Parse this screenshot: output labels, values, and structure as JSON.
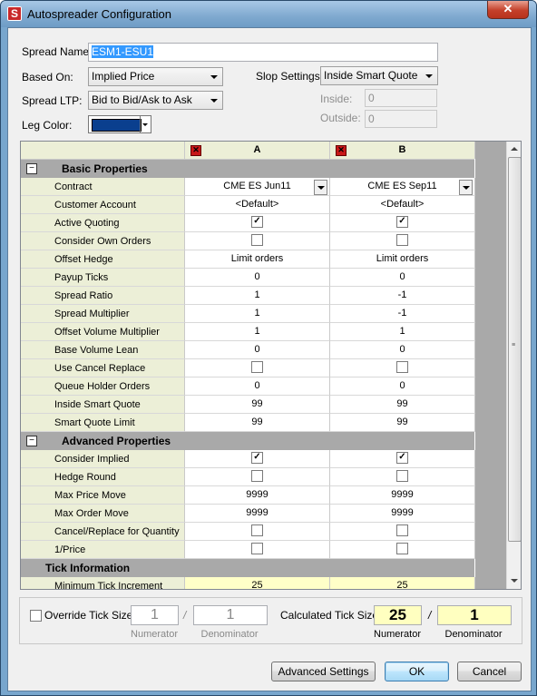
{
  "window": {
    "title": "Autospreader Configuration",
    "close_glyph": "✕"
  },
  "form": {
    "spread_name_label": "Spread Name:",
    "spread_name_value": "ESM1-ESU1",
    "based_on_label": "Based On:",
    "based_on_value": "Implied Price",
    "spread_ltp_label": "Spread LTP:",
    "spread_ltp_value": "Bid to Bid/Ask to Ask",
    "leg_color_label": "Leg Color:",
    "leg_color_value": "#0a3f8e",
    "slop_settings_label": "Slop Settings:",
    "slop_settings_value": "Inside Smart Quote",
    "inside_label": "Inside:",
    "inside_value": "0",
    "outside_label": "Outside:",
    "outside_value": "0"
  },
  "grid": {
    "col_a": "A",
    "col_b": "B",
    "sections": [
      {
        "title": "Basic Properties",
        "collapsible": true
      },
      {
        "title": "Advanced Properties",
        "collapsible": true
      },
      {
        "title": "Tick Information",
        "collapsible": false
      }
    ],
    "basic_rows": [
      {
        "label": "Contract",
        "a": "CME ES Jun11",
        "b": "CME ES Sep11",
        "kind": "dropdown"
      },
      {
        "label": "Customer Account",
        "a": "<Default>",
        "b": "<Default>",
        "kind": "text"
      },
      {
        "label": "Active Quoting",
        "a": "✓",
        "b": "✓",
        "kind": "check"
      },
      {
        "label": "Consider Own Orders",
        "a": "",
        "b": "",
        "kind": "check"
      },
      {
        "label": "Offset Hedge",
        "a": "Limit orders",
        "b": "Limit orders",
        "kind": "text"
      },
      {
        "label": "Payup Ticks",
        "a": "0",
        "b": "0",
        "kind": "text"
      },
      {
        "label": "Spread Ratio",
        "a": "1",
        "b": "-1",
        "kind": "text"
      },
      {
        "label": "Spread Multiplier",
        "a": "1",
        "b": "-1",
        "kind": "text"
      },
      {
        "label": "Offset Volume Multiplier",
        "a": "1",
        "b": "1",
        "kind": "text"
      },
      {
        "label": "Base Volume Lean",
        "a": "0",
        "b": "0",
        "kind": "text"
      },
      {
        "label": "Use Cancel Replace",
        "a": "",
        "b": "",
        "kind": "check"
      },
      {
        "label": "Queue Holder Orders",
        "a": "0",
        "b": "0",
        "kind": "text"
      },
      {
        "label": "Inside Smart Quote",
        "a": "99",
        "b": "99",
        "kind": "text"
      },
      {
        "label": "Smart Quote Limit",
        "a": "99",
        "b": "99",
        "kind": "text"
      }
    ],
    "advanced_rows": [
      {
        "label": "Consider Implied",
        "a": "✓",
        "b": "✓",
        "kind": "check"
      },
      {
        "label": "Hedge Round",
        "a": "",
        "b": "",
        "kind": "check"
      },
      {
        "label": "Max Price Move",
        "a": "9999",
        "b": "9999",
        "kind": "text"
      },
      {
        "label": "Max Order Move",
        "a": "9999",
        "b": "9999",
        "kind": "text"
      },
      {
        "label": "Cancel/Replace for Quantity",
        "a": "",
        "b": "",
        "kind": "check"
      },
      {
        "label": "1/Price",
        "a": "",
        "b": "",
        "kind": "check"
      }
    ],
    "tick_rows": [
      {
        "label": "Minimum Tick Increment",
        "a": "25",
        "b": "25",
        "kind": "yellow"
      }
    ]
  },
  "tick_panel": {
    "override_label": "Override Tick Size",
    "override_num": "1",
    "override_den": "1",
    "slash": "/",
    "numerator_label": "Numerator",
    "denominator_label": "Denominator",
    "calculated_label": "Calculated Tick Size",
    "calc_num": "25",
    "calc_den": "1"
  },
  "buttons": {
    "advanced": "Advanced Settings",
    "ok": "OK",
    "cancel": "Cancel"
  }
}
